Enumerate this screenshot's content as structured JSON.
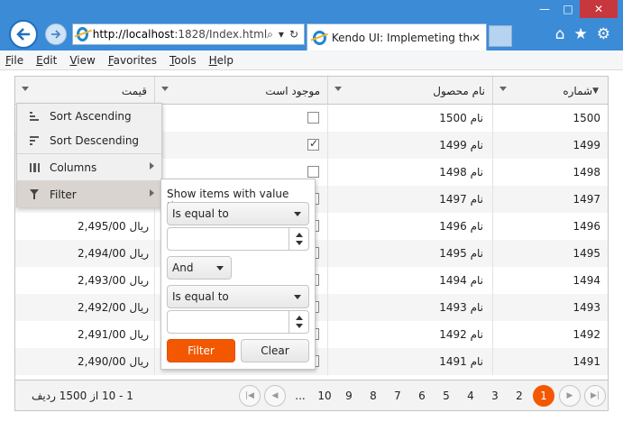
{
  "browser": {
    "url_host": "http://localhost",
    "url_rest": ":1828/Index.html",
    "tab_title": "Kendo UI: Implemeting the ...",
    "window_buttons": [
      "—",
      "□",
      "✕"
    ]
  },
  "menu": [
    "File",
    "Edit",
    "View",
    "Favorites",
    "Tools",
    "Help"
  ],
  "grid": {
    "columns": [
      "شماره",
      "نام محصول",
      "موجود است",
      "قیمت"
    ],
    "sort_indicator": "▼",
    "rows": [
      {
        "num": "1500",
        "name": "نام 1500",
        "checked": false,
        "price": ""
      },
      {
        "num": "1499",
        "name": "نام 1499",
        "checked": true,
        "price": ""
      },
      {
        "num": "1498",
        "name": "نام 1498",
        "checked": false,
        "price": ""
      },
      {
        "num": "1497",
        "name": "نام 1497",
        "checked": false,
        "price": ""
      },
      {
        "num": "1496",
        "name": "نام 1496",
        "checked": false,
        "price": "2,495/00 ریال"
      },
      {
        "num": "1495",
        "name": "نام 1495",
        "checked": false,
        "price": "2,494/00 ریال"
      },
      {
        "num": "1494",
        "name": "نام 1494",
        "checked": false,
        "price": "2,493/00 ریال"
      },
      {
        "num": "1493",
        "name": "نام 1493",
        "checked": false,
        "price": "2,492/00 ریال"
      },
      {
        "num": "1492",
        "name": "نام 1492",
        "checked": false,
        "price": "2,491/00 ریال"
      },
      {
        "num": "1491",
        "name": "نام 1491",
        "checked": false,
        "price": "2,490/00 ریال"
      }
    ]
  },
  "pager": {
    "pages": [
      "1",
      "2",
      "3",
      "4",
      "5",
      "6",
      "7",
      "8",
      "9",
      "10",
      "..."
    ],
    "current": "1",
    "info": "1 - 10 از 1500 ردیف"
  },
  "column_menu": {
    "sort_asc": "Sort Ascending",
    "sort_desc": "Sort Descending",
    "columns": "Columns",
    "filter": "Filter"
  },
  "filter_popup": {
    "hint": "Show items with value that:",
    "operator1": "Is equal to",
    "value1": "",
    "logic": "And",
    "operator2": "Is equal to",
    "value2": "",
    "filter_button": "Filter",
    "clear_button": "Clear"
  }
}
